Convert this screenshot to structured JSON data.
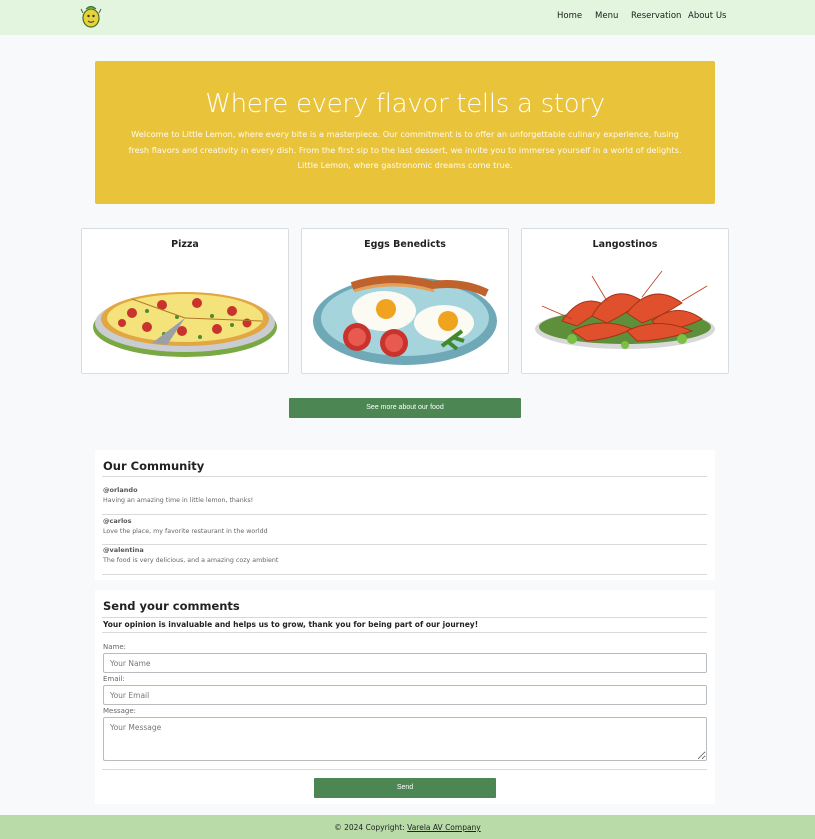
{
  "nav": {
    "logo_name": "little-lemon-logo",
    "links": [
      "Home",
      "Menu",
      "Reservation",
      "About Us"
    ]
  },
  "hero": {
    "title": "Where every flavor tells a story",
    "text": "Welcome to Little Lemon, where every bite is a masterpiece. Our commitment is to offer an unforgettable culinary experience, fusing fresh flavors and creativity in every dish. From the first sip to the last dessert, we invite you to immerse yourself in a world of delights. Little Lemon, where gastronomic dreams come true."
  },
  "dishes": [
    {
      "title": "Pizza",
      "icon": "pizza-image"
    },
    {
      "title": "Eggs Benedicts",
      "icon": "eggs-benedict-image"
    },
    {
      "title": "Langostinos",
      "icon": "langostinos-image"
    }
  ],
  "see_more_label": "See more about our food",
  "community": {
    "title": "Our Community",
    "comments": [
      {
        "user": "@orlando",
        "text": "Having an amazing time in little lemon, thanks!"
      },
      {
        "user": "@carlos",
        "text": "Love the place, my favorite restaurant in the worldd"
      },
      {
        "user": "@valentina",
        "text": "The food is very delicious, and a amazing cozy ambient"
      }
    ]
  },
  "form": {
    "title": "Send your comments",
    "subtitle": "Your opinion is invaluable and helps us to grow, thank you for being part of our journey!",
    "name_label": "Name:",
    "name_placeholder": "Your Name",
    "email_label": "Email:",
    "email_placeholder": "Your Email",
    "message_label": "Message:",
    "message_placeholder": "Your Message",
    "send_label": "Send"
  },
  "footer": {
    "text": "© 2024 Copyright:",
    "link": "Varela AV Company"
  },
  "colors": {
    "nav_bg": "#e3f5de",
    "hero_bg": "#e9c43a",
    "button_bg": "#4c8653",
    "footer_bg": "#b8dba8"
  }
}
